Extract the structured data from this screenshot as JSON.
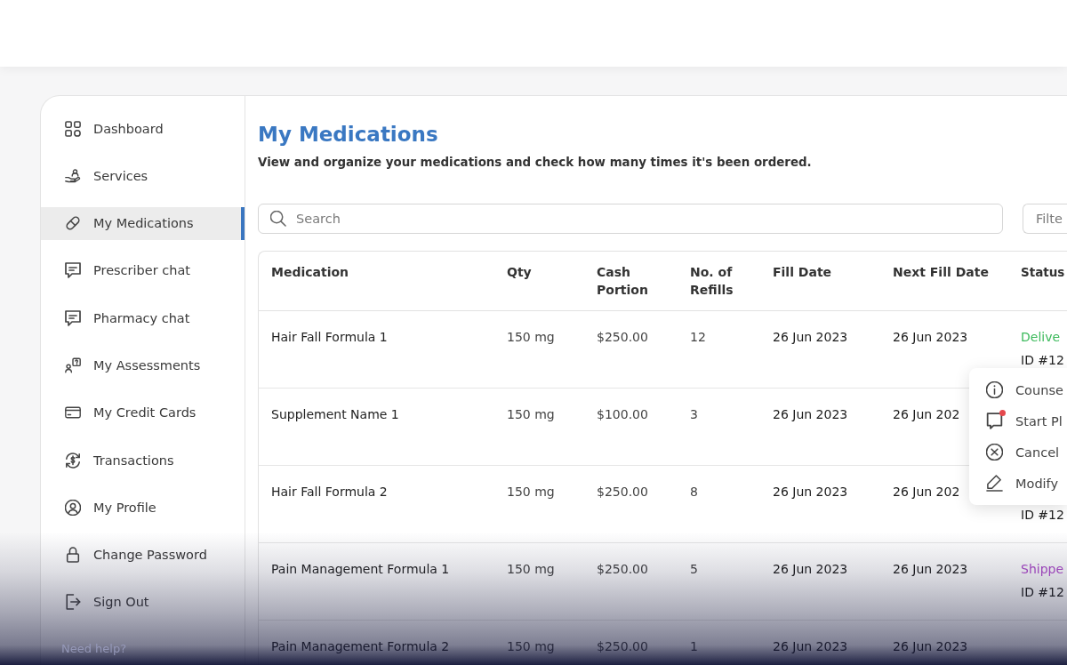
{
  "sidebar": {
    "items": [
      {
        "label": "Dashboard",
        "selected": false
      },
      {
        "label": "Services",
        "selected": false
      },
      {
        "label": "My Medications",
        "selected": true
      },
      {
        "label": "Prescriber chat",
        "selected": false
      },
      {
        "label": "Pharmacy chat",
        "selected": false
      },
      {
        "label": "My Assessments",
        "selected": false
      },
      {
        "label": "My Credit Cards",
        "selected": false
      },
      {
        "label": "Transactions",
        "selected": false
      },
      {
        "label": "My Profile",
        "selected": false
      },
      {
        "label": "Change Password",
        "selected": false
      },
      {
        "label": "Sign Out",
        "selected": false
      }
    ],
    "help_text": "Need help?"
  },
  "page": {
    "title": "My Medications",
    "subtitle": "View and organize your medications and check how many times it's been ordered."
  },
  "search": {
    "placeholder": "Search"
  },
  "filter": {
    "placeholder": "Filte"
  },
  "table": {
    "columns": [
      "Medication",
      "Qty",
      "Cash Portion",
      "No. of Refills",
      "Fill Date",
      "Next Fill Date",
      "Status"
    ],
    "rows": [
      {
        "cells": [
          "Hair Fall Formula 1",
          "150 mg",
          "$250.00",
          "12",
          "26 Jun 2023",
          "26 Jun 2023"
        ],
        "status": {
          "label": "Delive",
          "color": "#3dba5c"
        },
        "order_id": "ID #12"
      },
      {
        "cells": [
          "Supplement Name 1",
          "150 mg",
          "$100.00",
          "3",
          "26 Jun 2023",
          "26 Jun 202"
        ]
      },
      {
        "cells": [
          "Hair Fall Formula 2",
          "150 mg",
          "$250.00",
          "8",
          "26 Jun 2023",
          "26 Jun 202"
        ],
        "order_id": "ID #12"
      },
      {
        "cells": [
          "Pain Management Formula 1",
          "150 mg",
          "$250.00",
          "5",
          "26 Jun 2023",
          "26 Jun 2023"
        ],
        "status": {
          "label": "Shippe",
          "color": "#9a45b8"
        },
        "order_id": "ID #12"
      },
      {
        "cells": [
          "Pain Management Formula 2",
          "150 mg",
          "$250.00",
          "1",
          "26 Jun 2023",
          "26 Jun 2023"
        ]
      }
    ]
  },
  "row_menu": {
    "items": [
      {
        "label": "Counse",
        "unread": false
      },
      {
        "label": "Start Pl",
        "unread": true
      },
      {
        "label": "Cancel",
        "unread": false
      },
      {
        "label": "Modify",
        "unread": false
      }
    ]
  }
}
